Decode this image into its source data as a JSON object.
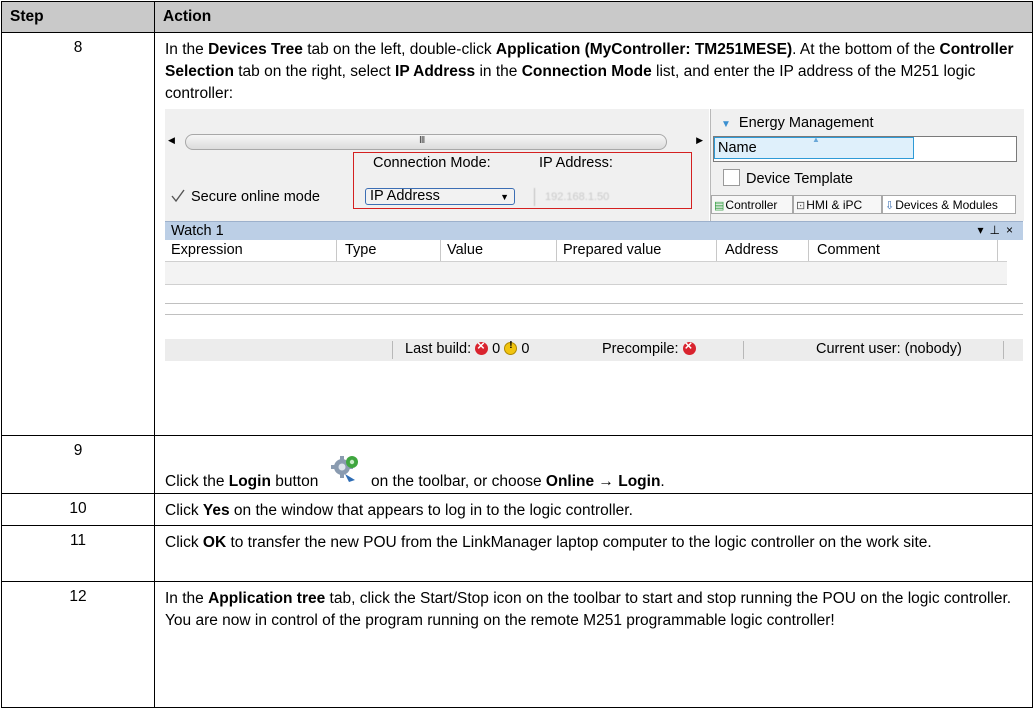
{
  "table": {
    "header_step": "Step",
    "header_action": "Action"
  },
  "rows": [
    {
      "step": "8",
      "parts": [
        "In the ",
        "Devices Tree",
        " tab on the left, double-click ",
        "Application (MyController: TM251MESE)",
        ". At the bottom of the ",
        "Controller Selection",
        " tab on the right, select ",
        "IP Address",
        " in the ",
        "Connection Mode",
        " list, and enter the IP address of the M251 logic controller:"
      ]
    },
    {
      "step": "9",
      "parts": [
        "Click the ",
        "Login",
        " button ",
        " on the toolbar, or choose ",
        "Online → Login",
        "."
      ]
    },
    {
      "step": "10",
      "parts": [
        "Click ",
        "Yes",
        " on the window that appears to log in to the logic controller."
      ]
    },
    {
      "step": "11",
      "parts": [
        "Click ",
        "OK",
        " to transfer the new POU from the LinkManager laptop computer to the logic controller on the work site."
      ]
    },
    {
      "step": "12",
      "parts": [
        "In the ",
        "Application tree",
        " tab, click the Start/Stop icon on the toolbar to start and stop running the POU on the logic controller."
      ],
      "line2": "You are now in control of the program running on the remote M251 programmable logic controller!"
    }
  ],
  "screenshot": {
    "scroll_grip": "III",
    "secure_online_mode": "Secure online mode",
    "connection_mode_label": "Connection Mode:",
    "connection_mode_value": "IP Address",
    "ip_address_label": "IP Address:",
    "ip_address_value": "192.168.1.50",
    "energy_management": "Energy Management",
    "name_column": "Name",
    "device_template": "Device Template",
    "tabs": [
      "Controller",
      "HMI & iPC",
      "Devices & Modules"
    ],
    "watch_title": "Watch 1",
    "watch_columns": [
      "Expression",
      "Type",
      "Value",
      "Prepared value",
      "Address",
      "Comment"
    ],
    "last_build_label": "Last build:",
    "errors": "0",
    "warnings": "0",
    "precompile_label": "Precompile:",
    "current_user": "Current user: (nobody)"
  }
}
